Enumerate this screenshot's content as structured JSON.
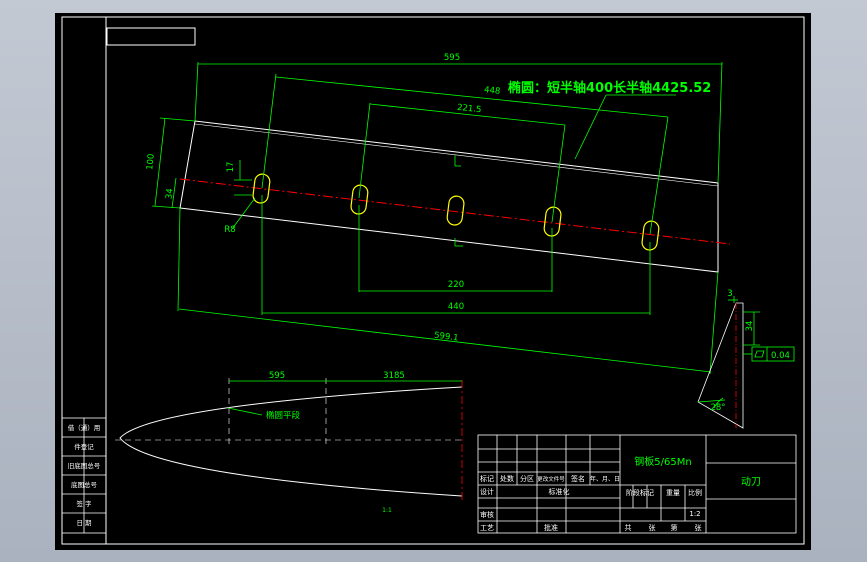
{
  "drawing": {
    "main_dims": {
      "overall_length": "595",
      "hole_span_outer": "448",
      "hole_span_inner": "221.5",
      "height_total": "100",
      "height_hole_axis": "34",
      "slot_width": "17",
      "slot_radius": "R8",
      "bottom_inner": "220",
      "bottom_outer": "440",
      "diagonal_length": "599.1"
    },
    "ellipse_note": "椭圆：短半轴400长半轴4425.52",
    "section": {
      "thickness": "3",
      "angle": "28°",
      "flatness_value": "0.04"
    },
    "lower_view": {
      "dim_left": "595",
      "dim_right": "3185",
      "label": "椭圆平段",
      "scale_note": "1:1"
    },
    "left_strip": {
      "rows": [
        "借（通）用",
        "件登记",
        "旧底图总号",
        "底图总号",
        "签  字",
        "日  期"
      ]
    },
    "title_block": {
      "material": "钢板5/65Mn",
      "part_name": "动刀",
      "scale": "1:2",
      "headers": [
        "标记",
        "处数",
        "分区",
        "更改文件号",
        "签名",
        "年、月、日"
      ],
      "role_design": "设计",
      "role_standard": "标准化",
      "role_review": "审核",
      "role_process": "工艺",
      "role_approve": "批准",
      "stage_mark": "阶段标记",
      "weight": "重量",
      "scale_label": "比例",
      "sheet_parts": [
        "共",
        "张",
        "第",
        "张"
      ]
    },
    "colors": {
      "frame": "#ffffff",
      "geometry": "#ffffff",
      "dimension": "#00ff00",
      "centerline": "#ff0000",
      "slot": "#ffff00"
    }
  }
}
